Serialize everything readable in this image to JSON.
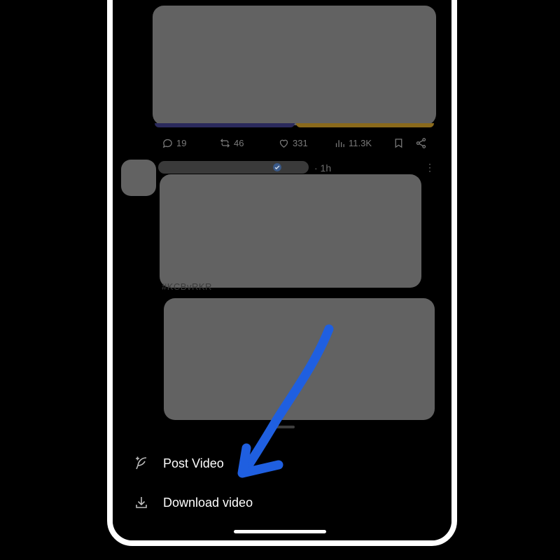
{
  "timeline": {
    "post1": {
      "actions": {
        "replies": "19",
        "reposts": "46",
        "likes": "331",
        "views": "11.3K"
      }
    },
    "post2": {
      "time": "· 1h",
      "more": "⋮",
      "hashtag": "#KCBvRKR"
    }
  },
  "sheet": {
    "post_video_label": "Post Video",
    "download_video_label": "Download video"
  },
  "colors": {
    "annotation_arrow": "#1f5fe0",
    "redaction_gray": "#626262",
    "icon_gray": "#7a7a7a",
    "text_white": "#ffffff",
    "background": "#000000"
  },
  "icons": {
    "reply": "comment-icon",
    "repost": "repost-icon",
    "like": "heart-icon",
    "views": "views-chart-icon",
    "bookmark": "bookmark-icon",
    "share": "share-icon",
    "post_video": "feather-plus-icon",
    "download": "download-icon"
  }
}
